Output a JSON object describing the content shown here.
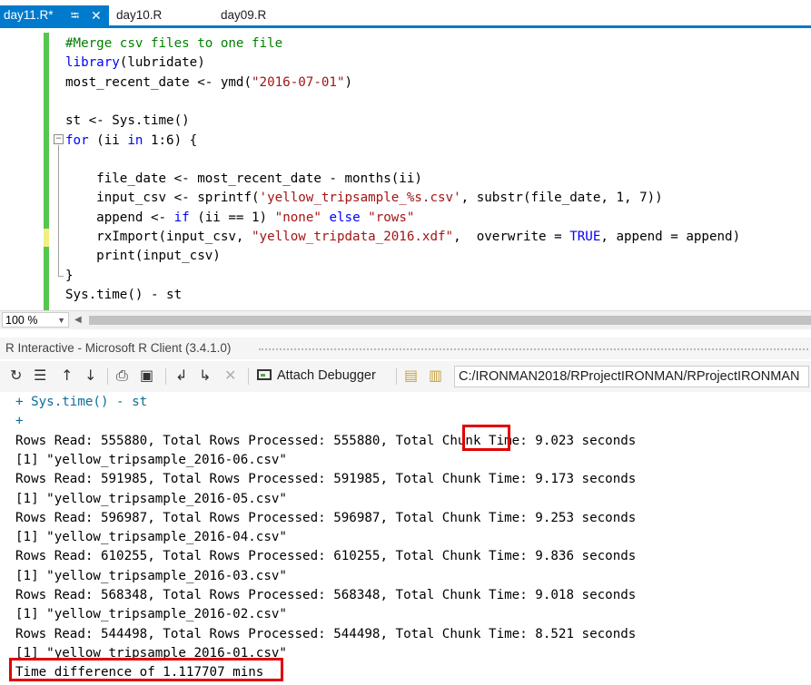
{
  "tabs": [
    {
      "label": "day11.R*",
      "active": true
    },
    {
      "label": "day10.R",
      "active": false
    },
    {
      "label": "day09.R",
      "active": false
    }
  ],
  "icons": {
    "pin": "⭾",
    "close": "✕",
    "restart": "↻",
    "clear": "☰",
    "up": "↑",
    "down": "↓",
    "print": "⎙",
    "save": "▣",
    "load": "↲",
    "load_all": "↳",
    "stop": "✕",
    "folder": "▤",
    "folder_open": "▥"
  },
  "editor": {
    "lines": [
      {
        "segments": [
          {
            "t": "#Merge csv files to one file",
            "c": "comment"
          }
        ]
      },
      {
        "segments": [
          {
            "t": "library",
            "c": "kw"
          },
          {
            "t": "(lubridate)",
            "c": ""
          }
        ]
      },
      {
        "segments": [
          {
            "t": "most_recent_date <- ymd(",
            "c": ""
          },
          {
            "t": "\"2016-07-01\"",
            "c": "str"
          },
          {
            "t": ")",
            "c": ""
          }
        ]
      },
      {
        "segments": [
          {
            "t": "",
            "c": ""
          }
        ]
      },
      {
        "segments": [
          {
            "t": "st <- Sys.time()",
            "c": ""
          }
        ]
      },
      {
        "segments": [
          {
            "t": "for",
            "c": "kw"
          },
          {
            "t": " (ii ",
            "c": ""
          },
          {
            "t": "in",
            "c": "kw"
          },
          {
            "t": " 1:6) {",
            "c": ""
          }
        ]
      },
      {
        "segments": [
          {
            "t": "",
            "c": ""
          }
        ]
      },
      {
        "segments": [
          {
            "t": "    file_date <- most_recent_date - months(ii)",
            "c": ""
          }
        ]
      },
      {
        "segments": [
          {
            "t": "    input_csv <- sprintf(",
            "c": ""
          },
          {
            "t": "'yellow_tripsample_%s.csv'",
            "c": "str"
          },
          {
            "t": ", substr(file_date, 1, 7))",
            "c": ""
          }
        ]
      },
      {
        "segments": [
          {
            "t": "    append <- ",
            "c": ""
          },
          {
            "t": "if",
            "c": "kw"
          },
          {
            "t": " (ii == 1) ",
            "c": ""
          },
          {
            "t": "\"none\"",
            "c": "str"
          },
          {
            "t": " ",
            "c": ""
          },
          {
            "t": "else",
            "c": "kw"
          },
          {
            "t": " ",
            "c": ""
          },
          {
            "t": "\"rows\"",
            "c": "str"
          }
        ]
      },
      {
        "segments": [
          {
            "t": "    rxImport(input_csv, ",
            "c": ""
          },
          {
            "t": "\"yellow_tripdata_2016.xdf\"",
            "c": "str"
          },
          {
            "t": ",  overwrite = ",
            "c": ""
          },
          {
            "t": "TRUE",
            "c": "kw"
          },
          {
            "t": ", append = append)",
            "c": ""
          }
        ]
      },
      {
        "segments": [
          {
            "t": "    print(input_csv)",
            "c": ""
          }
        ]
      },
      {
        "segments": [
          {
            "t": "}",
            "c": ""
          }
        ]
      },
      {
        "segments": [
          {
            "t": "Sys.time() - st",
            "c": ""
          }
        ]
      }
    ]
  },
  "zoom": {
    "value": "100 %"
  },
  "interactive": {
    "title": "R Interactive - Microsoft R Client (3.4.1.0)",
    "attach_label": "Attach Debugger",
    "working_dir": "C:/IRONMAN2018/RProjectIRONMAN/RProjectIRONMAN"
  },
  "console": {
    "lines": [
      "+ Sys.time() - st",
      "+",
      "Rows Read: 555880, Total Rows Processed: 555880, Total Chunk Time: 9.023 seconds",
      "[1] \"yellow_tripsample_2016-06.csv\"",
      "Rows Read: 591985, Total Rows Processed: 591985, Total Chunk Time: 9.173 seconds",
      "[1] \"yellow_tripsample_2016-05.csv\"",
      "Rows Read: 596987, Total Rows Processed: 596987, Total Chunk Time: 9.253 seconds",
      "[1] \"yellow_tripsample_2016-04.csv\"",
      "Rows Read: 610255, Total Rows Processed: 610255, Total Chunk Time: 9.836 seconds",
      "[1] \"yellow_tripsample_2016-03.csv\"",
      "Rows Read: 568348, Total Rows Processed: 568348, Total Chunk Time: 9.018 seconds",
      "[1] \"yellow_tripsample_2016-02.csv\"",
      "Rows Read: 544498, Total Rows Processed: 544498, Total Chunk Time: 8.521 seconds",
      "[1] \"yellow_tripsample_2016-01.csv\"",
      "Time difference of 1.117707 mins"
    ]
  },
  "colors": {
    "accent": "#007acc",
    "changed_bar": "#57c64e",
    "highlight_box": "#e00000",
    "keyword": "#0000ff",
    "string": "#a31515",
    "comment": "#008000"
  }
}
